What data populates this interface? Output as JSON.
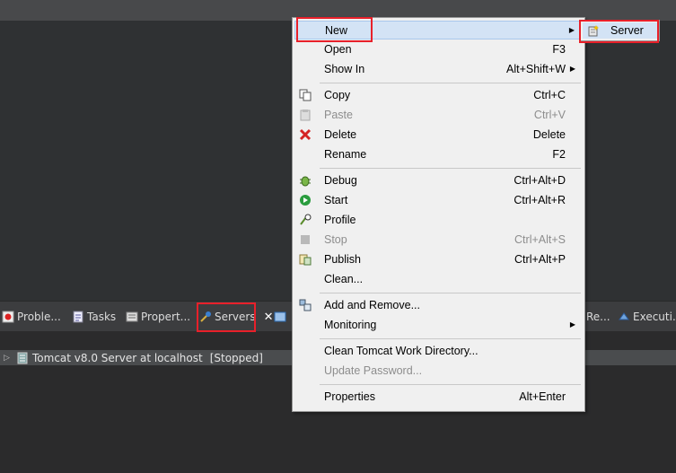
{
  "context_menu": {
    "items": [
      {
        "label": "New",
        "shortcut": "",
        "submenu": true
      },
      {
        "label": "Open",
        "shortcut": "F3"
      },
      {
        "label": "Show In",
        "shortcut": "Alt+Shift+W",
        "submenu": true
      },
      {
        "label": "Copy",
        "shortcut": "Ctrl+C",
        "icon": "copy-icon"
      },
      {
        "label": "Paste",
        "shortcut": "Ctrl+V",
        "icon": "paste-icon",
        "disabled": true
      },
      {
        "label": "Delete",
        "shortcut": "Delete",
        "icon": "delete-icon"
      },
      {
        "label": "Rename",
        "shortcut": "F2"
      },
      {
        "label": "Debug",
        "shortcut": "Ctrl+Alt+D",
        "icon": "debug-icon"
      },
      {
        "label": "Start",
        "shortcut": "Ctrl+Alt+R",
        "icon": "start-icon"
      },
      {
        "label": "Profile",
        "shortcut": "",
        "icon": "profile-icon"
      },
      {
        "label": "Stop",
        "shortcut": "Ctrl+Alt+S",
        "icon": "stop-icon",
        "disabled": true
      },
      {
        "label": "Publish",
        "shortcut": "Ctrl+Alt+P",
        "icon": "publish-icon"
      },
      {
        "label": "Clean...",
        "shortcut": ""
      },
      {
        "label": "Add and Remove...",
        "shortcut": "",
        "icon": "add-remove-icon"
      },
      {
        "label": "Monitoring",
        "shortcut": "",
        "submenu": true
      },
      {
        "label": "Clean Tomcat Work Directory...",
        "shortcut": ""
      },
      {
        "label": "Update Password...",
        "shortcut": "",
        "disabled": true
      },
      {
        "label": "Properties",
        "shortcut": "Alt+Enter"
      }
    ]
  },
  "submenu_new": {
    "item_label": "Server",
    "icon": "new-server-icon"
  },
  "tabs": [
    {
      "label": "Proble...",
      "icon": "problems-icon"
    },
    {
      "label": "Tasks",
      "icon": "tasks-icon"
    },
    {
      "label": "Propert...",
      "icon": "properties-icon"
    },
    {
      "label": "Servers",
      "icon": "servers-icon",
      "active": true
    },
    {
      "label": "Re...",
      "icon": ""
    },
    {
      "label": "Executi...",
      "icon": "execution-icon"
    }
  ],
  "server_entry": {
    "name": "Tomcat v8.0 Server at localhost",
    "status": "[Stopped]"
  },
  "colors": {
    "highlight_box": "#e8202a",
    "menu_bg": "#f0f0f0",
    "selection": "#d3e3f5"
  }
}
